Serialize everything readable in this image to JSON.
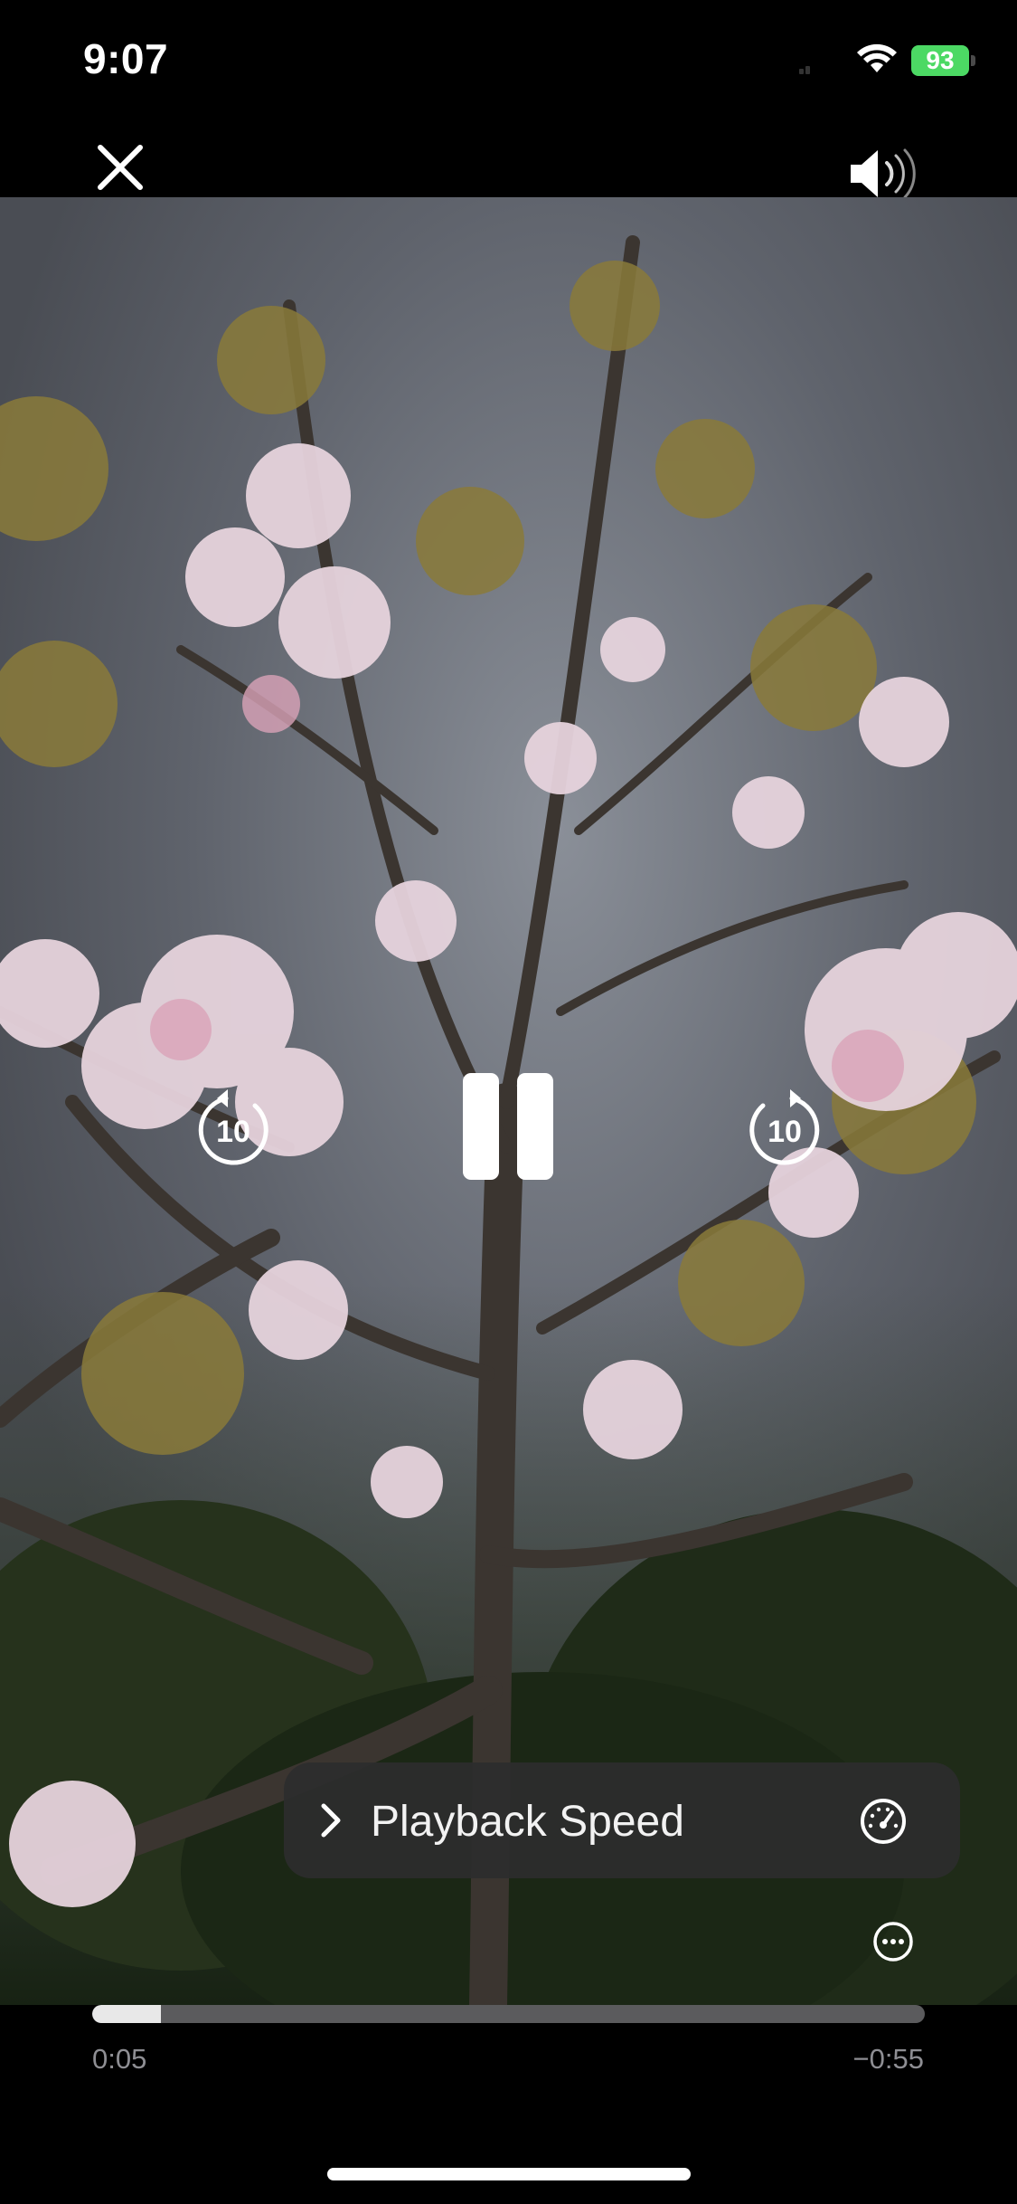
{
  "status_bar": {
    "time": "9:07",
    "battery": "93",
    "icons": [
      "wifi-icon",
      "battery-icon"
    ]
  },
  "controls": {
    "close_icon": "close-icon",
    "volume_icon": "speaker-volume-icon",
    "skip_back_label": "10",
    "skip_forward_label": "10",
    "skip_back_icon": "rewind-10-icon",
    "skip_forward_icon": "forward-10-icon",
    "pause_icon": "pause-icon"
  },
  "speed_menu": {
    "label": "Playback Speed",
    "chevron_icon": "chevron-right-icon",
    "speed_icon": "speedometer-icon"
  },
  "more_icon": "ellipsis-circle-icon",
  "playback": {
    "elapsed": "0:05",
    "remaining": "−0:55",
    "progress_fraction": 0.083
  },
  "colors": {
    "battery_green": "#4cd964",
    "panel_bg": "#2c2c2e",
    "time_gray": "#8e8e93",
    "track_gray": "#5b5b5d"
  }
}
